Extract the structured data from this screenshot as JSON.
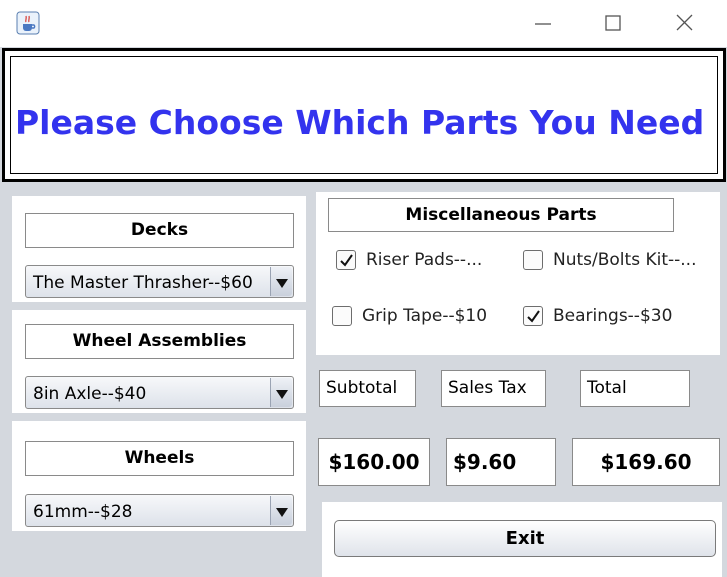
{
  "window": {
    "app_icon": "java-cup-icon",
    "controls": [
      "minimize-icon",
      "maximize-icon",
      "close-icon"
    ]
  },
  "header": {
    "title": "Please Choose Which Parts You Need",
    "title_color": "#3333ee"
  },
  "decks": {
    "label": "Decks",
    "selected": "The Master Thrasher--$60"
  },
  "wheel_assemblies": {
    "label": "Wheel Assemblies",
    "selected": "8in Axle--$40"
  },
  "wheels": {
    "label": "Wheels",
    "selected": "61mm--$28"
  },
  "misc": {
    "label": "Miscellaneous Parts",
    "items": [
      {
        "label": "Riser Pads--...",
        "checked": true
      },
      {
        "label": "Nuts/Bolts Kit--...",
        "checked": false
      },
      {
        "label": "Grip Tape--$10",
        "checked": false
      },
      {
        "label": "Bearings--$30",
        "checked": true
      }
    ]
  },
  "totals": {
    "subtotal_label": "Subtotal",
    "sales_tax_label": "Sales Tax",
    "total_label": "Total",
    "subtotal_value": "$160.00",
    "sales_tax_value": "$9.60",
    "total_value": "$169.60"
  },
  "actions": {
    "exit_label": "Exit"
  }
}
